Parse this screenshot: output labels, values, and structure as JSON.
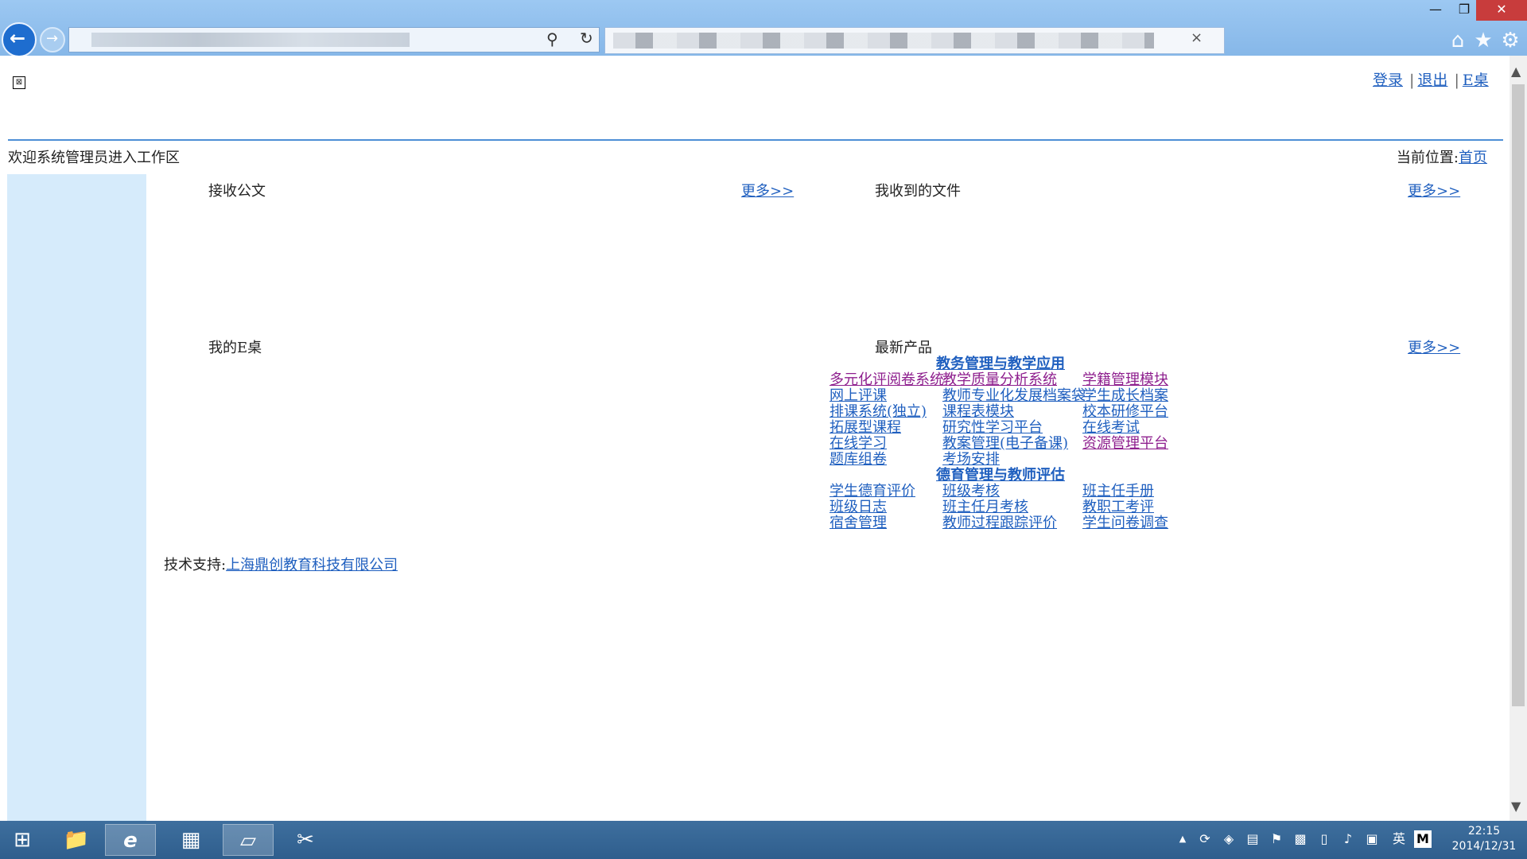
{
  "window": {
    "minimize_glyph": "—",
    "maximize_glyph": "❐",
    "close_glyph": "✕",
    "tab_close_glyph": "×"
  },
  "toolbar": {
    "back_glyph": "←",
    "forward_glyph": "→",
    "search_glyph": "⚲",
    "refresh_glyph": "↻",
    "home_glyph": "⌂",
    "favorites_glyph": "★",
    "tools_glyph": "⚙"
  },
  "header": {
    "broken_image_glyph": "⊠",
    "login": "登录",
    "logout": "退出",
    "edesk": "E桌",
    "separator": "|",
    "welcome": "欢迎系统管理员进入工作区",
    "location_label": "当前位置:",
    "location_home": "首页"
  },
  "panels": {
    "received_docs": {
      "title": "接收公文",
      "more": "更多>>"
    },
    "received_files": {
      "title": "我收到的文件",
      "more": "更多>>"
    },
    "my_edesk": {
      "title": "我的E桌"
    },
    "latest_products": {
      "title": "最新产品",
      "more": "更多>>"
    }
  },
  "products": {
    "cat1": "教务管理与教学应用",
    "r1": {
      "a": "多元化评阅卷系统",
      "b": "教学质量分析系统",
      "c": "学籍管理模块"
    },
    "r2": {
      "a": "网上评课",
      "b": "教师专业化发展档案袋",
      "c": "学生成长档案"
    },
    "r3": {
      "a": "排课系统(独立)",
      "b": "课程表模块",
      "c": "校本研修平台"
    },
    "r4": {
      "a": "拓展型课程",
      "b": "研究性学习平台",
      "c": "在线考试"
    },
    "r5": {
      "a": "在线学习",
      "b": "教案管理(电子备课)",
      "c": "资源管理平台"
    },
    "r6": {
      "a": "题库组卷",
      "b": "考场安排"
    },
    "cat2": "德育管理与教师评估",
    "r7": {
      "a": "学生德育评价",
      "b": "班级考核",
      "c": "班主任手册"
    },
    "r8": {
      "a": "班级日志",
      "b": "班主任月考核",
      "c": "教职工考评"
    },
    "r9": {
      "a": "宿舍管理",
      "b": "教师过程跟踪评价",
      "c": "学生问卷调查"
    }
  },
  "footer": {
    "support_label": "技术支持:",
    "support_company": "上海鼎创教育科技有限公司"
  },
  "taskbar": {
    "start_glyph": "⊞",
    "explorer_glyph": "📁",
    "ie_glyph": "e",
    "calculator_glyph": "▦",
    "notepad_glyph": "▱",
    "snip_glyph": "✂",
    "tray_expand": "▲",
    "ime": "英",
    "ime_mode": "M",
    "time": "22:15",
    "date": "2014/12/31"
  },
  "colors": {
    "titlebar": "#9cc8f2",
    "link": "#1f5fbf",
    "visited_link": "#8e1f8e",
    "sidebar": "#d6ebfb",
    "taskbar": "#2f5e8d",
    "close_button": "#c83c3c"
  }
}
